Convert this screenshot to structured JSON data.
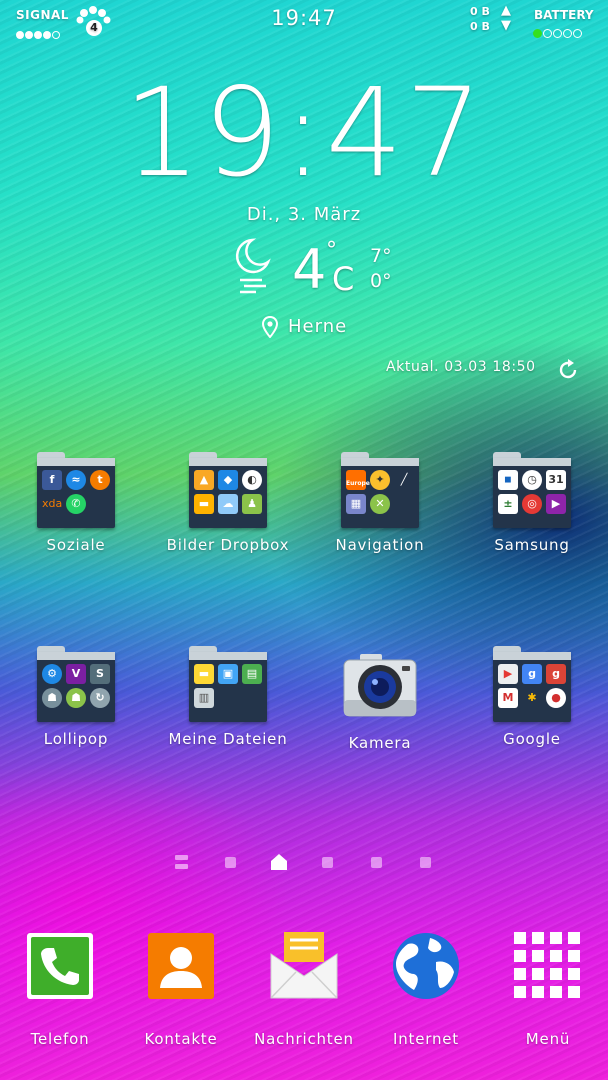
{
  "status_bar": {
    "signal_label": "SIGNAL",
    "network_badge": "4",
    "time": "19:47",
    "traffic_up": "0 B",
    "traffic_down": "0 B",
    "battery_label": "BATTERY"
  },
  "clock_widget": {
    "time": "19:47",
    "date": "Di., 3. März",
    "temperature": "4",
    "degree_symbol": "°",
    "unit": "C",
    "high": "7°",
    "low": "0°",
    "location": "Herne",
    "updated": "Aktual. 03.03 18:50",
    "weather_icon": "moon-cloud-icon"
  },
  "apps": [
    {
      "label": "Soziale"
    },
    {
      "label": "Bilder Dropbox"
    },
    {
      "label": "Navigation"
    },
    {
      "label": "Samsung"
    },
    {
      "label": "Lollipop"
    },
    {
      "label": "Meine Dateien"
    },
    {
      "label": "Kamera"
    },
    {
      "label": "Google"
    }
  ],
  "soziale_icons": {
    "xda": "xda",
    "tumblr": "t"
  },
  "samsung_icons": {
    "calendar_day": "31"
  },
  "lollipop_icons": {
    "viber": "V"
  },
  "navigation_icons": {
    "europe": "Europe"
  },
  "pager": {
    "pages": 6,
    "current": 3
  },
  "dock": [
    {
      "label": "Telefon"
    },
    {
      "label": "Kontakte"
    },
    {
      "label": "Nachrichten"
    },
    {
      "label": "Internet"
    },
    {
      "label": "Menü"
    }
  ],
  "colors": {
    "battery_green": "#35e020",
    "folder_body": "#23344a",
    "folder_lip": "#c9d2d8"
  }
}
